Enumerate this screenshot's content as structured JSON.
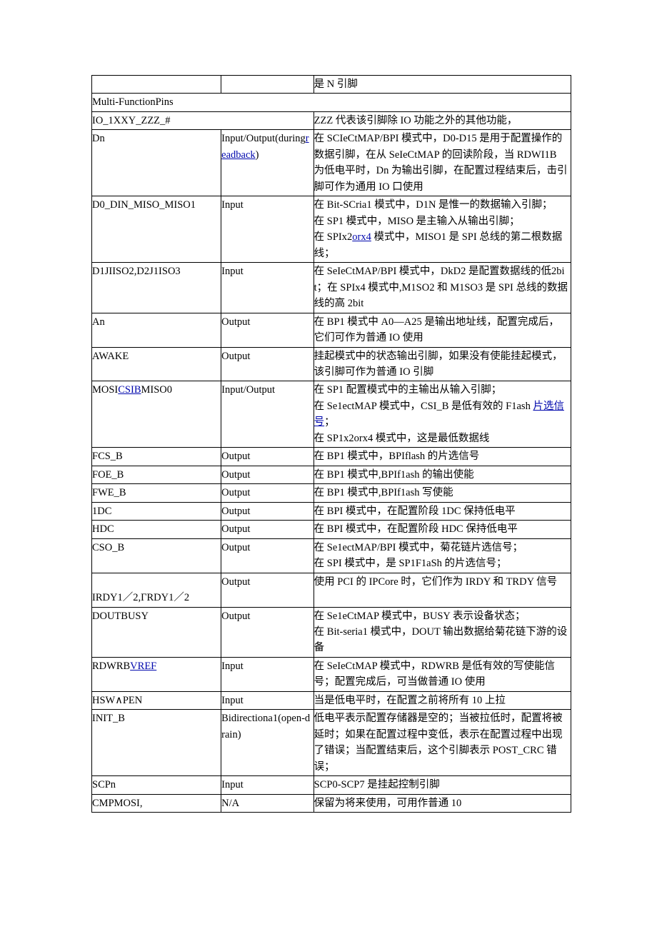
{
  "rows": [
    {
      "c1": "",
      "c2": "",
      "c3": "是 N 引脚"
    },
    {
      "c1": "Multi-FunctionPins",
      "span": 3
    },
    {
      "c1": "IO_1XXY_ZZZ_#",
      "span12": true,
      "c3": "ZZZ 代表该引脚除 IO 功能之外的其他功能，"
    },
    {
      "c1": "Dn",
      "c2_pre": "Input/Output(during",
      "c2_link": "readback",
      "c2_post": ")",
      "c3": "在 SCIeCtMAP/BPI 模式中，D0-D15 是用于配置操作的数据引脚，在从 SeIeCtMAP 的回读阶段，当 RDWI1B 为低电平时，Dn 为输出引脚，在配置过程结束后，击引脚可作为通用 IO 口使用"
    },
    {
      "c1": "D0_DIN_MISO_MISO1",
      "c2": "Input",
      "c3_pre": "在 Bit-SCria1 模式中，D1N 是惟一的数据输入引脚；\n在 SP1 模式中，MISO 是主输入从输出引脚；\n在 SPIx2",
      "c3_link": "orx4",
      "c3_post": " 模式中，MISO1 是 SPI 总线的第二根数据线；"
    },
    {
      "c1": "D1JIISO2,D2J1ISO3",
      "c2": "Input",
      "c3": "在 SeIeCtMAP/BPI 模式中，DkD2 是配置数据线的低2bit；在 SPIx4 模式中,M1SO2 和 M1SO3 是 SPI 总线的数据线的高 2bit"
    },
    {
      "c1": "An",
      "c2": "Output",
      "c3": "在 BP1 模式中 A0—A25 是输出地址线，配置完成后，它们可作为普通 IO 使用"
    },
    {
      "c1": "AWAKE",
      "c2": "Output",
      "c3": "挂起模式中的状态输出引脚，如果没有使能挂起模式，该引脚可作为普通 IO 引脚"
    },
    {
      "c1_pre": "MOSI",
      "c1_link": "CSIB",
      "c1_post": "MISO0",
      "c2": "Input/Output",
      "c3_pre": "在 SP1 配置模式中的主输出从输入引脚；\n在 Se1ectMAP 模式中，CSI_B 是低有效的 F1ash ",
      "c3_link": "片选信号",
      "c3_post": "；\n在 SP1x2orx4 模式中，这是最低数据线"
    },
    {
      "c1": "FCS_B",
      "c2": "Output",
      "c3": "在 BP1 模式中，BPIflash 的片选信号"
    },
    {
      "c1": "FOE_B",
      "c2": "Output",
      "c3": "在 BP1 模式中,BPIf1ash 的输出使能"
    },
    {
      "c1": "FWE_B",
      "c2": "Output",
      "c3": "在 BP1 模式中,BPIf1ash 写使能"
    },
    {
      "c1": "1DC",
      "c2": "Output",
      "c3": "在 BPI 模式中，在配置阶段 1DC 保持低电平"
    },
    {
      "c1": "HDC",
      "c2": "Output",
      "c3": "在 BPI 模式中，在配置阶段 HDC 保持低电平"
    },
    {
      "c1": "CSO_B",
      "c2": "Output",
      "c3": "在 Se1ectMAP/BPI 模式中，菊花链片选信号；\n在 SPI 模式中，是 SP1F1aSh 的片选信号；"
    },
    {
      "c1": "\nIRDY1／2,ΓRDY1／2",
      "c2": "Output",
      "c3": "使用 PCI 的 IPCore 时，它们作为 IRDY 和 TRDY 信号"
    },
    {
      "c1": "DOUTBUSY",
      "c2": "Output",
      "c3": "在 Se1eCtMAP 模式中，BUSY 表示设备状态；\n在 Bit-seria1 模式中，DOUT 输出数据给菊花链下游的设备"
    },
    {
      "c1_pre": "RDWRB",
      "c1_link": "VREF",
      "c1_post": "",
      "c2": "Input",
      "c3": "在 SeIeCtMAP 模式中，RDWRB 是低有效的写使能信号；配置完成后，可当做普通 IO 使用"
    },
    {
      "c1": "HSW∧PEN",
      "c2": "Input",
      "c3": "当是低电平时，在配置之前将所有 10 上拉"
    },
    {
      "c1": "INIT_B",
      "c2": "Bidirectiona1(open-drain)",
      "c3": "低电平表示配置存储器是空的；当被拉低时，配置将被延时；如果在配置过程中变低，表示在配置过程中出现了错误；当配置结束后，这个引脚表示 POST_CRC 错误；"
    },
    {
      "c1": "SCPn",
      "c2": "Input",
      "c3": "SCP0-SCP7 是挂起控制引脚"
    },
    {
      "c1": "CMPMOSI,",
      "c2": "N/A",
      "c3": "保留为将来使用，可用作普通 10"
    }
  ]
}
